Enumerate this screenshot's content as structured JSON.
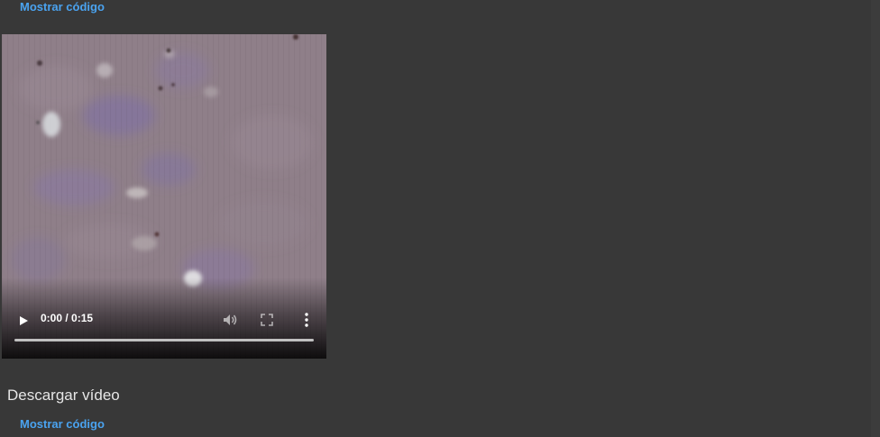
{
  "cells": {
    "show_code_top": "Mostrar código",
    "show_code_bottom": "Mostrar código",
    "download_label": "Descargar vídeo"
  },
  "video": {
    "time_display": "0:00 / 0:15",
    "progress": 0,
    "icons": {
      "play": "play-icon",
      "volume": "volume-icon",
      "fullscreen": "fullscreen-icon",
      "more": "more-options-icon"
    }
  },
  "colors": {
    "background": "#383838",
    "link": "#4aa3f0",
    "text": "#e6e6e6"
  }
}
